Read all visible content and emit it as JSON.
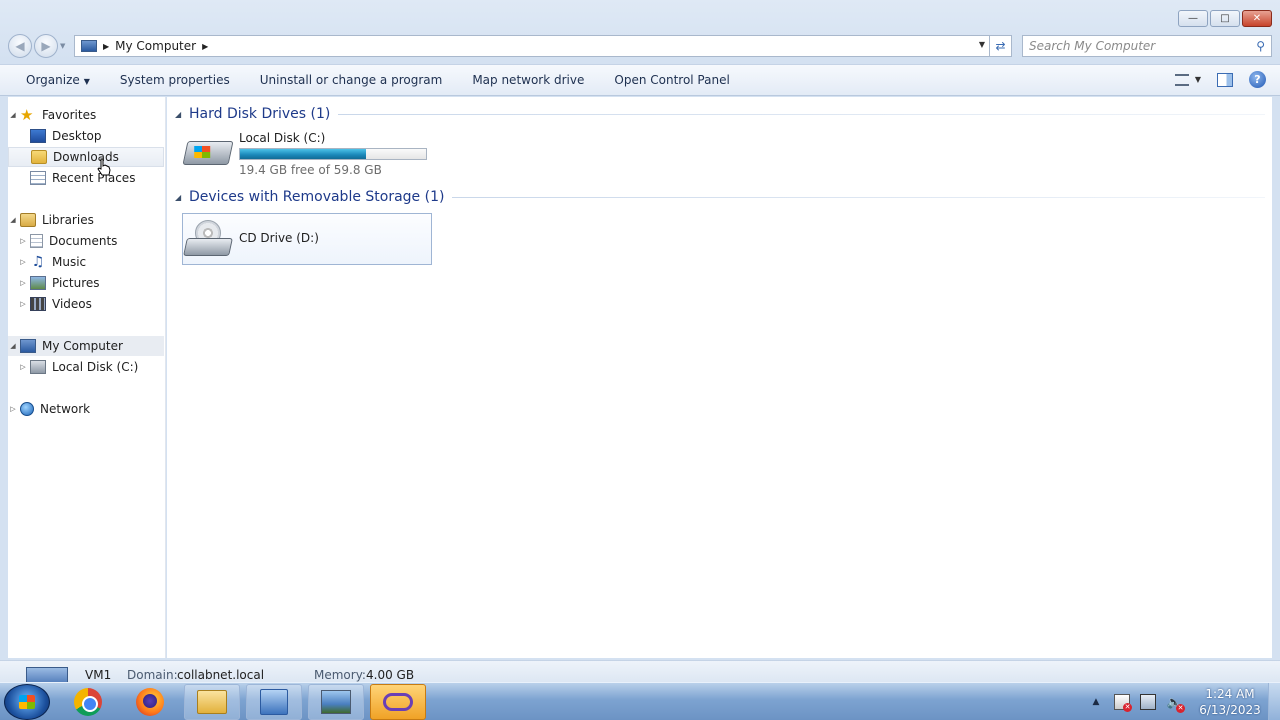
{
  "address": {
    "path": [
      "My Computer"
    ],
    "search_placeholder": "Search My Computer"
  },
  "toolbar": {
    "organize": "Organize",
    "system_properties": "System properties",
    "uninstall": "Uninstall or change a program",
    "map_drive": "Map network drive",
    "control_panel": "Open Control Panel"
  },
  "nav": {
    "favorites": "Favorites",
    "desktop": "Desktop",
    "downloads": "Downloads",
    "recent_places": "Recent Places",
    "libraries": "Libraries",
    "documents": "Documents",
    "music": "Music",
    "pictures": "Pictures",
    "videos": "Videos",
    "my_computer": "My Computer",
    "local_disk": "Local Disk (C:)",
    "network": "Network"
  },
  "content": {
    "hdd_group": "Hard Disk Drives (1)",
    "removable_group": "Devices with Removable Storage (1)",
    "local_disk": {
      "name": "Local Disk (C:)",
      "free_text": "19.4 GB free of 59.8 GB",
      "used_fraction": 0.676
    },
    "cd_drive": {
      "name": "CD Drive (D:)"
    }
  },
  "details": {
    "name": "VM1",
    "domain_label": "Domain:",
    "domain_value": "collabnet.local",
    "memory_label": "Memory:",
    "memory_value": "4.00 GB"
  },
  "taskbar": {
    "time": "1:24 AM",
    "date": "6/13/2023"
  },
  "icons": {
    "back": "back-arrow-icon",
    "forward": "forward-arrow-icon",
    "refresh": "refresh-icon",
    "search": "search-icon",
    "help": "help-icon"
  }
}
